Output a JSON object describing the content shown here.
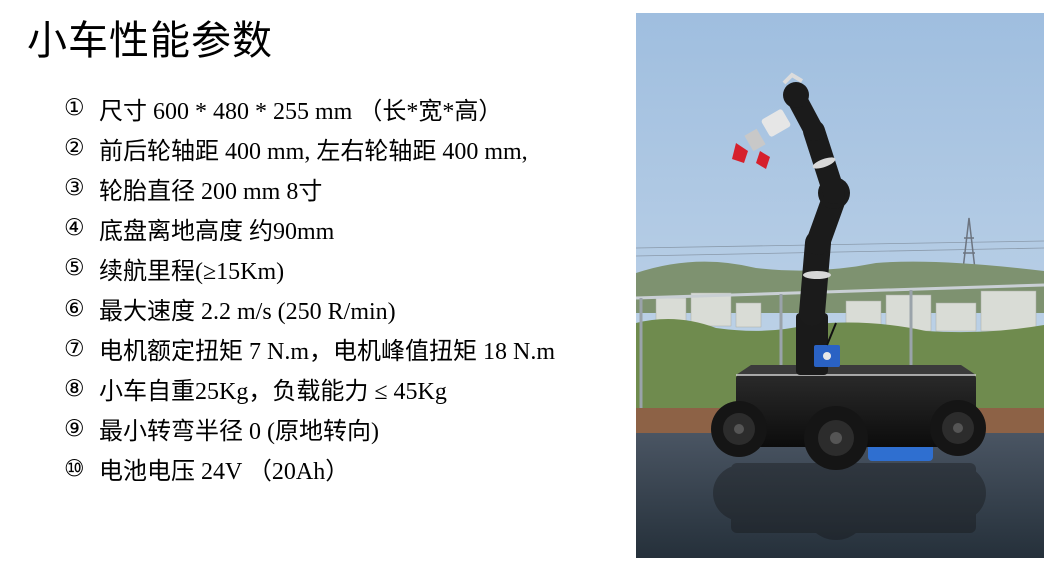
{
  "title": "小车性能参数",
  "specs": [
    {
      "num": "①",
      "text": "尺寸 600 * 480 * 255 mm （长*宽*高）"
    },
    {
      "num": "②",
      "text": "前后轮轴距 400 mm, 左右轮轴距 400 mm,"
    },
    {
      "num": "③",
      "text": "轮胎直径 200 mm   8寸"
    },
    {
      "num": "④",
      "text": "底盘离地高度 约90mm"
    },
    {
      "num": "⑤",
      "text": "续航里程(≥15Km)"
    },
    {
      "num": "⑥",
      "text": "最大速度 2.2 m/s (250 R/min)"
    },
    {
      "num": "⑦",
      "text": "电机额定扭矩 7 N.m，电机峰值扭矩 18 N.m"
    },
    {
      "num": "⑧",
      "text": "小车自重25Kg，负载能力 ≤ 45Kg"
    },
    {
      "num": "⑨",
      "text": "最小转弯半径 0 (原地转向)"
    },
    {
      "num": "⑩",
      "text": "电池电压 24V （20Ah）"
    }
  ]
}
